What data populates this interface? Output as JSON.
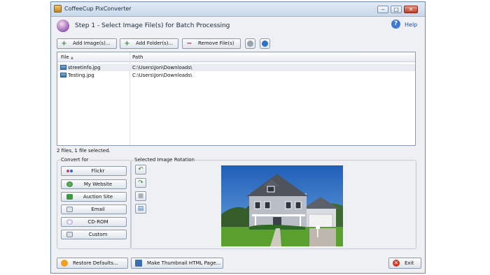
{
  "window": {
    "title": "CoffeeCup PixConverter",
    "controls": {
      "minimize": "‒",
      "maximize": "□",
      "close": "✕"
    }
  },
  "header": {
    "step_title": "Step 1 - Select Image File(s) for Batch Processing",
    "help_label": "Help",
    "help_glyph": "?"
  },
  "toolbar": {
    "add_images": "Add Image(s)...",
    "add_folder": "Add Folder(s)...",
    "remove_files": "Remove File(s)",
    "plus_glyph": "+",
    "minus_glyph": "−"
  },
  "file_list": {
    "columns": {
      "file": "File",
      "path": "Path"
    },
    "sort_indicator": "▲",
    "rows": [
      {
        "name": "streetinfo.jpg",
        "path": "C:\\Users\\Jon\\Downloads\\"
      },
      {
        "name": "Testing.jpg",
        "path": "C:\\Users\\Jon\\Downloads\\"
      }
    ]
  },
  "status": "2 files, 1 file selected.",
  "convert_for": {
    "title": "Convert for",
    "buttons": [
      "Flickr",
      "My Website",
      "Auction Site",
      "Email",
      "CD-ROM",
      "Custom"
    ]
  },
  "rotation": {
    "title": "Selected Image Rotation",
    "glyphs": [
      "↶",
      "↷",
      "■",
      "▤"
    ]
  },
  "bottom": {
    "restore": "Restore Defaults...",
    "thumbnail": "Make Thumbnail HTML Page...",
    "exit": "Exit"
  },
  "colors": {
    "accent": "#1d4fa8",
    "flickr_pink": "#e0327a",
    "flickr_blue": "#1e6fd0",
    "exit_red": "#d23a23"
  }
}
